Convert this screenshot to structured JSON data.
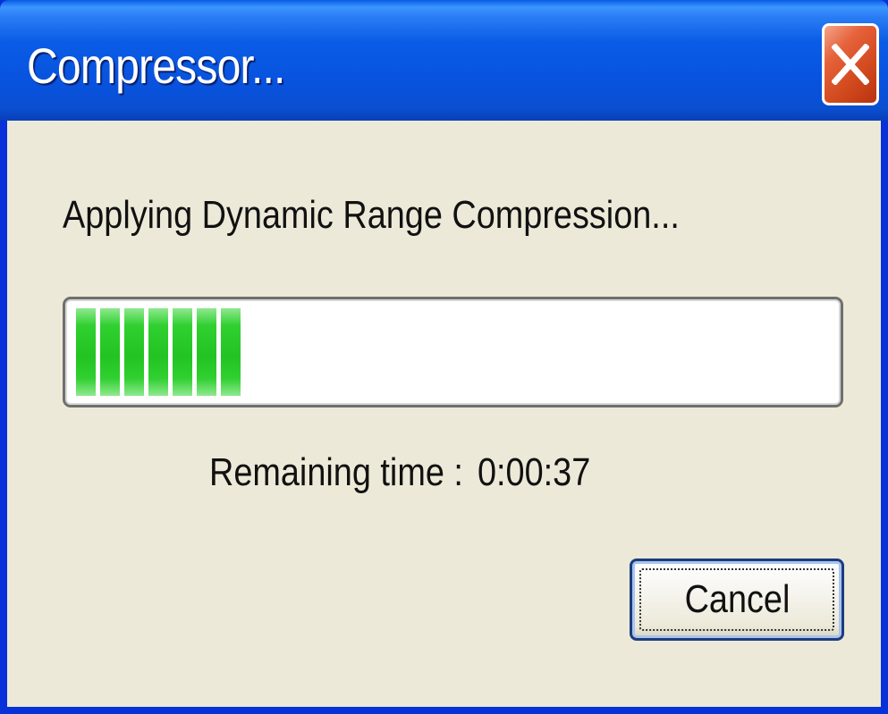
{
  "window": {
    "title": "Compressor...",
    "close_icon": "close-x-icon"
  },
  "dialog": {
    "status_text": "Applying Dynamic Range Compression...",
    "progress": {
      "fraction": 0.21,
      "fill_color": "#22c322"
    },
    "remaining_label": "Remaining time :",
    "remaining_value": "0:00:37",
    "cancel_label": "Cancel"
  },
  "colors": {
    "titlebar": "#0a5ce6",
    "close_button": "#d24a1e",
    "dialog_background": "#ece9d8"
  }
}
